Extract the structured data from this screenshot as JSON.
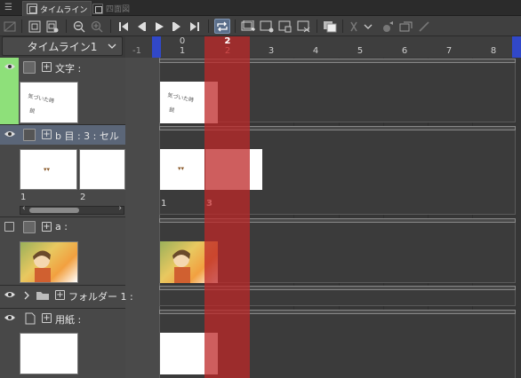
{
  "tabs": [
    {
      "label": "タイムライン",
      "active": true
    },
    {
      "label": "四面図",
      "active": false
    }
  ],
  "timeline_selector": {
    "value": "タイムライン1"
  },
  "ruler": {
    "negative_label": "-1",
    "current_frame": "2",
    "frames_top": [
      "0"
    ],
    "frames": [
      "1",
      "2",
      "3",
      "4",
      "5",
      "6",
      "7",
      "8"
    ]
  },
  "layers": [
    {
      "name": "文字 :",
      "visible": true,
      "color": "#8ee07a",
      "thumbnail": "handwritten text"
    },
    {
      "name": "b  目 : 3 : セル",
      "visible": true,
      "selected": true,
      "cells": [
        "1",
        "2"
      ]
    },
    {
      "name": "a :",
      "visible": false,
      "thumbnail": "character illustration"
    },
    {
      "name": "フォルダー 1 :",
      "visible": true,
      "folder": true
    },
    {
      "name": "用紙 :",
      "visible": true,
      "thumbnail": "white paper"
    }
  ],
  "track_cells": {
    "layer_b": [
      "1",
      "3"
    ]
  },
  "colors": {
    "playhead": "#b82a2a",
    "selection": "#5b6678",
    "layer_color_tag": "#8ee07a",
    "range_marker": "#3148c8"
  }
}
